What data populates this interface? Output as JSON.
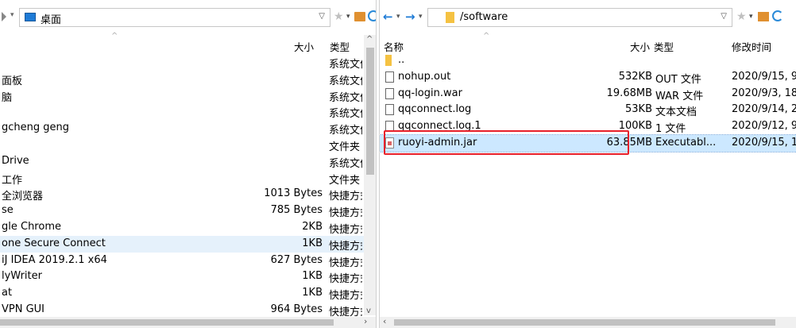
{
  "left": {
    "path": "桌面",
    "headers": {
      "size": "大小",
      "type": "类型"
    },
    "rows": [
      {
        "name": "",
        "size": "",
        "type": "系统文件"
      },
      {
        "name": "面板",
        "size": "",
        "type": "系统文件"
      },
      {
        "name": "脑",
        "size": "",
        "type": "系统文件"
      },
      {
        "name": "",
        "size": "",
        "type": "系统文件"
      },
      {
        "name": "gcheng geng",
        "size": "",
        "type": "系统文件"
      },
      {
        "name": "",
        "size": "",
        "type": "文件夹"
      },
      {
        "name": "Drive",
        "size": "",
        "type": "系统文件"
      },
      {
        "name": "工作",
        "size": "",
        "type": "文件夹"
      },
      {
        "name": "全浏览器",
        "size": "1013 Bytes",
        "type": "快捷方式"
      },
      {
        "name": "se",
        "size": "785 Bytes",
        "type": "快捷方式"
      },
      {
        "name": "gle Chrome",
        "size": "2KB",
        "type": "快捷方式"
      },
      {
        "name": "one Secure Connect",
        "size": "1KB",
        "type": "快捷方式"
      },
      {
        "name": "iJ IDEA 2019.2.1 x64",
        "size": "627 Bytes",
        "type": "快捷方式"
      },
      {
        "name": "lyWriter",
        "size": "1KB",
        "type": "快捷方式"
      },
      {
        "name": "at",
        "size": "1KB",
        "type": "快捷方式"
      },
      {
        "name": "VPN GUI",
        "size": "964 Bytes",
        "type": "快捷方式"
      }
    ],
    "selected_index": 11
  },
  "right": {
    "path": "/software",
    "headers": {
      "name": "名称",
      "size": "大小",
      "type": "类型",
      "modified": "修改时间"
    },
    "rows": [
      {
        "name": "..",
        "size": "",
        "type": "",
        "modified": "",
        "icon": "folder-icon"
      },
      {
        "name": "nohup.out",
        "size": "532KB",
        "type": "OUT 文件",
        "modified": "2020/9/15, 9",
        "icon": "file-icon"
      },
      {
        "name": "qq-login.war",
        "size": "19.68MB",
        "type": "WAR 文件",
        "modified": "2020/9/3, 18",
        "icon": "file-icon"
      },
      {
        "name": "qqconnect.log",
        "size": "53KB",
        "type": "文本文档",
        "modified": "2020/9/14, 2",
        "icon": "text-file-icon"
      },
      {
        "name": "qqconnect.log.1",
        "size": "100KB",
        "type": "1 文件",
        "modified": "2020/9/12, 9",
        "icon": "file-icon"
      },
      {
        "name": "ruoyi-admin.jar",
        "size": "63.85MB",
        "type": "Executabl...",
        "modified": "2020/9/15, 1",
        "icon": "jar-icon"
      }
    ],
    "selected_index": 5,
    "highlight_color": "#e8202a"
  },
  "colors": {
    "selection": "#cce8ff",
    "left_selection": "#e5f1fb",
    "folder": "#f5c242",
    "accent": "#1e7bd6"
  }
}
